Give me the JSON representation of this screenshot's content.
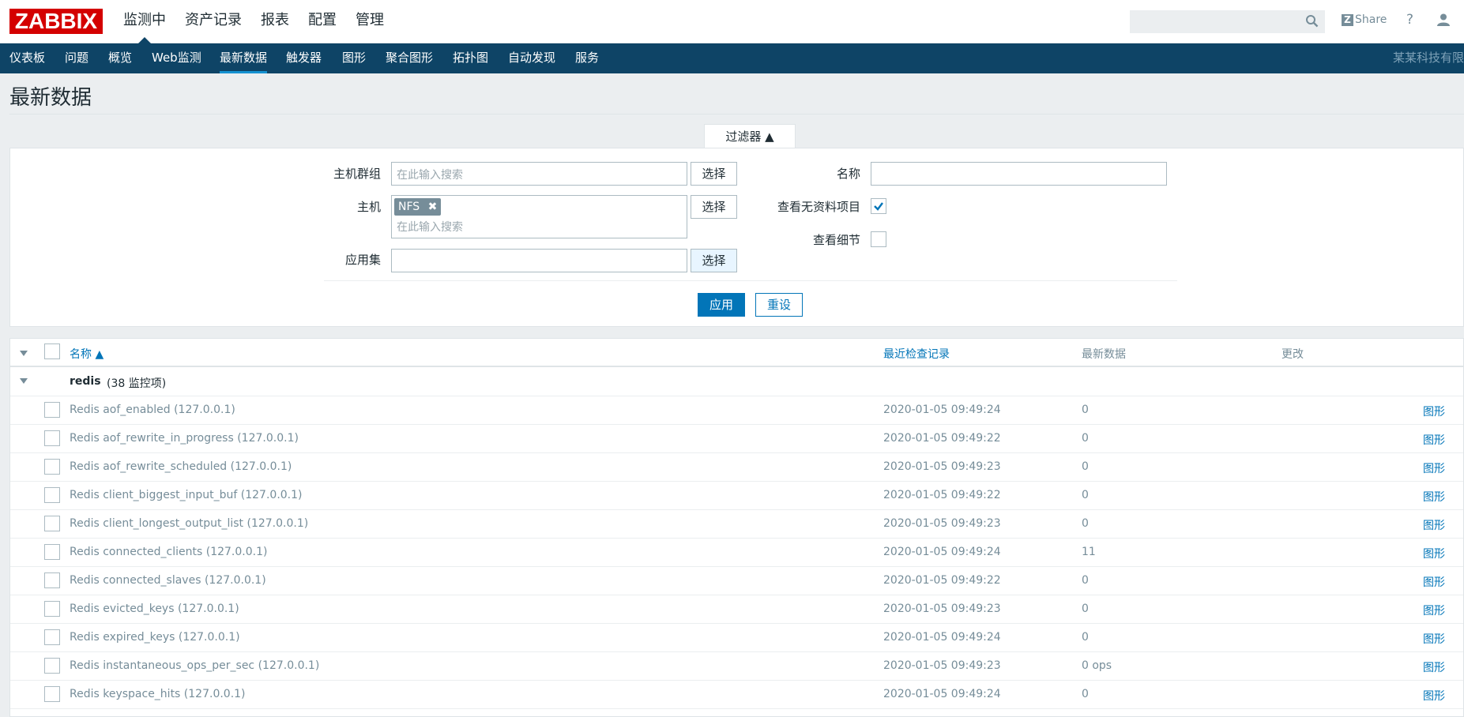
{
  "app": {
    "logo": "ZABBIX",
    "main_menu": [
      "监测中",
      "资产记录",
      "报表",
      "配置",
      "管理"
    ],
    "share_label": "Share",
    "help_label": "?"
  },
  "subnav": {
    "items": [
      "仪表板",
      "问题",
      "概览",
      "Web监测",
      "最新数据",
      "触发器",
      "图形",
      "聚合图形",
      "拓扑图",
      "自动发现",
      "服务"
    ],
    "active": "最新数据",
    "company": "某某科技有限"
  },
  "page": {
    "title": "最新数据"
  },
  "filter": {
    "tab_label": "过滤器 ▲",
    "host_group_label": "主机群组",
    "host_group_placeholder": "在此输入搜索",
    "host_label": "主机",
    "host_tag": "NFS",
    "host_placeholder": "在此输入搜索",
    "app_label": "应用集",
    "select_label": "选择",
    "name_label": "名称",
    "name_value": "",
    "show_without_data_label": "查看无资料项目",
    "show_without_data_checked": true,
    "show_details_label": "查看细节",
    "show_details_checked": false,
    "apply_label": "应用",
    "reset_label": "重设"
  },
  "table": {
    "headers": {
      "name": "名称 ▲",
      "last_check": "最近检查记录",
      "last_value": "最新数据",
      "change": "更改"
    },
    "group": {
      "name": "redis",
      "count": "(38 监控项)"
    },
    "rows": [
      {
        "name": "Redis aof_enabled (127.0.0.1)",
        "last_check": "2020-01-05 09:49:24",
        "value": "0",
        "link": "图形"
      },
      {
        "name": "Redis aof_rewrite_in_progress (127.0.0.1)",
        "last_check": "2020-01-05 09:49:22",
        "value": "0",
        "link": "图形"
      },
      {
        "name": "Redis aof_rewrite_scheduled (127.0.0.1)",
        "last_check": "2020-01-05 09:49:23",
        "value": "0",
        "link": "图形"
      },
      {
        "name": "Redis client_biggest_input_buf (127.0.0.1)",
        "last_check": "2020-01-05 09:49:22",
        "value": "0",
        "link": "图形"
      },
      {
        "name": "Redis client_longest_output_list (127.0.0.1)",
        "last_check": "2020-01-05 09:49:23",
        "value": "0",
        "link": "图形"
      },
      {
        "name": "Redis connected_clients (127.0.0.1)",
        "last_check": "2020-01-05 09:49:24",
        "value": "11",
        "link": "图形"
      },
      {
        "name": "Redis connected_slaves (127.0.0.1)",
        "last_check": "2020-01-05 09:49:22",
        "value": "0",
        "link": "图形"
      },
      {
        "name": "Redis evicted_keys (127.0.0.1)",
        "last_check": "2020-01-05 09:49:23",
        "value": "0",
        "link": "图形"
      },
      {
        "name": "Redis expired_keys (127.0.0.1)",
        "last_check": "2020-01-05 09:49:24",
        "value": "0",
        "link": "图形"
      },
      {
        "name": "Redis instantaneous_ops_per_sec (127.0.0.1)",
        "last_check": "2020-01-05 09:49:23",
        "value": "0 ops",
        "link": "图形"
      },
      {
        "name": "Redis keyspace_hits (127.0.0.1)",
        "last_check": "2020-01-05 09:49:24",
        "value": "0",
        "link": "图形"
      }
    ]
  },
  "colors": {
    "accent": "#0275b8",
    "nav": "#0e4466",
    "logo": "#d40000"
  }
}
